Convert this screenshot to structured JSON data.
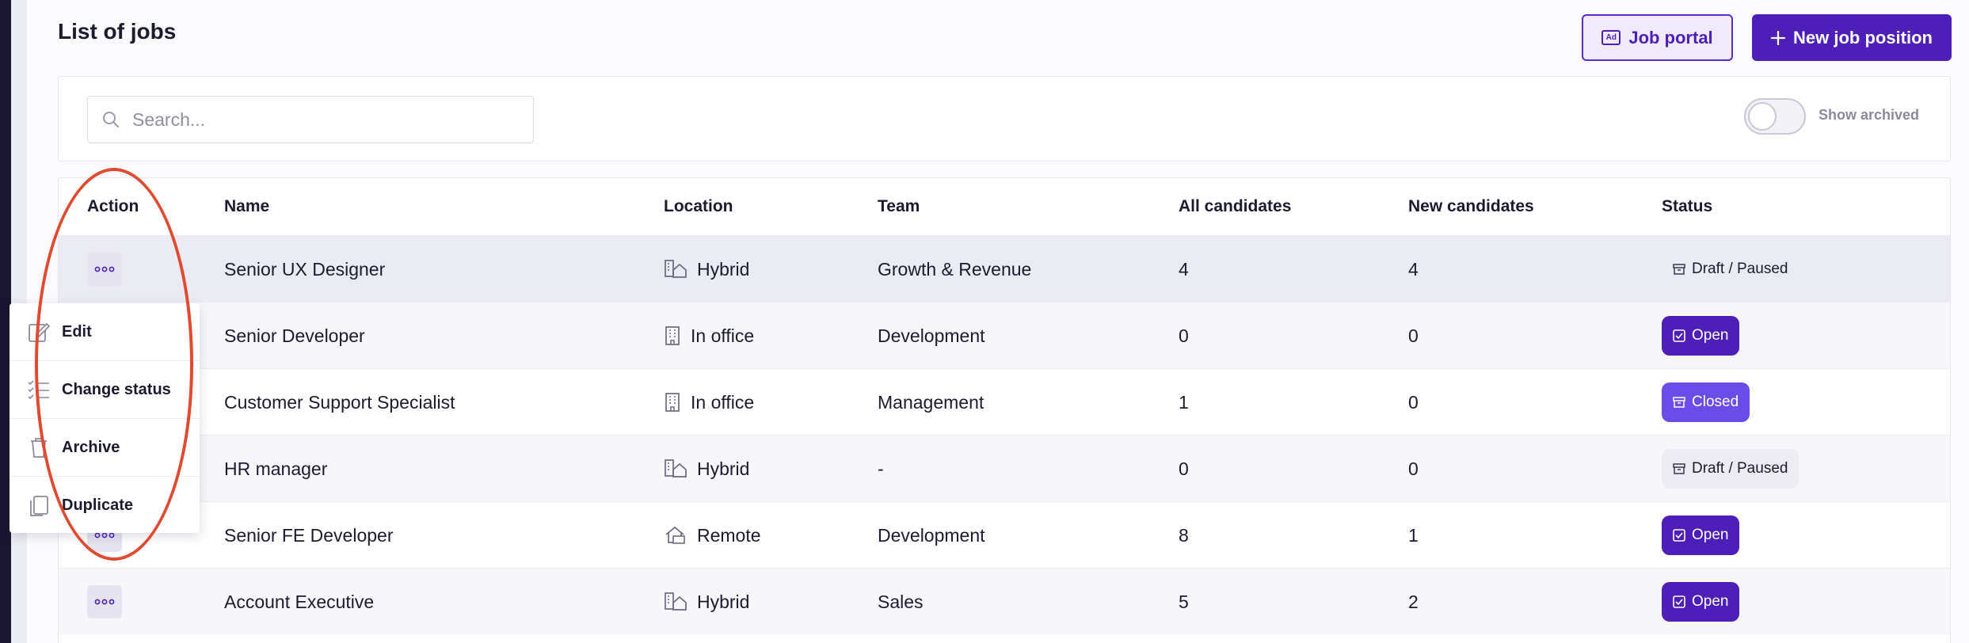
{
  "header": {
    "title": "List of jobs",
    "job_portal_label": "Job portal",
    "job_portal_icon": "Ad",
    "new_job_label": "New job position"
  },
  "filters": {
    "search_placeholder": "Search...",
    "search_value": "",
    "show_archived_label": "Show archived",
    "show_archived_on": false
  },
  "table": {
    "columns": [
      "Action",
      "Name",
      "Location",
      "Team",
      "All candidates",
      "New candidates",
      "Status"
    ],
    "rows": [
      {
        "name": "Senior UX Designer",
        "location": "Hybrid",
        "location_icon": "hybrid-icon",
        "team": "Growth & Revenue",
        "all": "4",
        "new": "4",
        "status": "Draft / Paused",
        "status_type": "draft"
      },
      {
        "name": "Senior Developer",
        "location": "In office",
        "location_icon": "office-building-icon",
        "team": "Development",
        "all": "0",
        "new": "0",
        "status": "Open",
        "status_type": "open"
      },
      {
        "name": "Customer Support Specialist",
        "location": "In office",
        "location_icon": "office-building-icon",
        "team": "Management",
        "all": "1",
        "new": "0",
        "status": "Closed",
        "status_type": "closed"
      },
      {
        "name": "HR manager",
        "location": "Hybrid",
        "location_icon": "hybrid-icon",
        "team": "-",
        "all": "0",
        "new": "0",
        "status": "Draft / Paused",
        "status_type": "draft"
      },
      {
        "name": "Senior FE Developer",
        "location": "Remote",
        "location_icon": "remote-home-icon",
        "team": "Development",
        "all": "8",
        "new": "1",
        "status": "Open",
        "status_type": "open"
      },
      {
        "name": "Account Executive",
        "location": "Hybrid",
        "location_icon": "hybrid-icon",
        "team": "Sales",
        "all": "5",
        "new": "2",
        "status": "Open",
        "status_type": "open"
      }
    ]
  },
  "action_menu": {
    "items": [
      {
        "label": "Edit",
        "icon": "edit-icon"
      },
      {
        "label": "Change status",
        "icon": "checklist-icon"
      },
      {
        "label": "Archive",
        "icon": "trash-icon"
      },
      {
        "label": "Duplicate",
        "icon": "copy-icon"
      }
    ]
  },
  "colors": {
    "brand": "#4d1fb8",
    "closed": "#6a4de8",
    "annotation": "#e2492f"
  }
}
